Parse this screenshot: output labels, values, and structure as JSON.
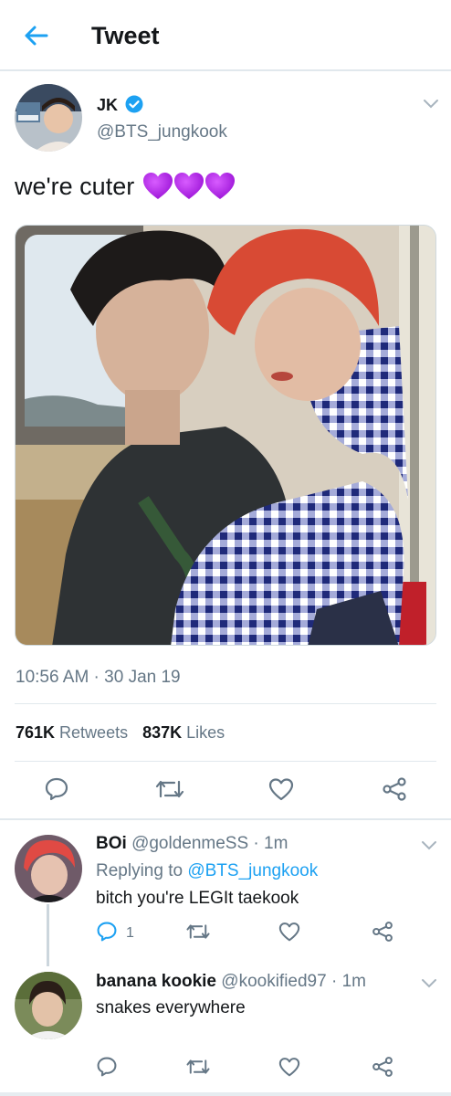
{
  "header": {
    "title": "Tweet",
    "back_icon": "arrow-left-icon",
    "accent": "#1da1f2"
  },
  "tweet": {
    "author_name": "JK",
    "verified": true,
    "handle": "@BTS_jungkook",
    "text": "we're cuter",
    "emoji": "purple-heart-icon x3",
    "timestamp": "10:56 AM · 30 Jan 19",
    "retweets_count": "761K",
    "retweets_label": "Retweets",
    "likes_count": "837K",
    "likes_label": "Likes"
  },
  "replies": [
    {
      "name": "BOi",
      "handle": "@goldenmeSS · 1m",
      "replying_prefix": "Replying to",
      "replying_to": "@BTS_jungkook",
      "text": "bitch you're LEGIt taekook",
      "reply_count": "1"
    },
    {
      "name": "banana kookie",
      "handle": "@kookified97 · 1m",
      "text": "snakes everywhere"
    }
  ],
  "colors": {
    "text": "#14171a",
    "secondary": "#657786",
    "divider": "#e1e8ed",
    "heart": "#b01ee6"
  }
}
